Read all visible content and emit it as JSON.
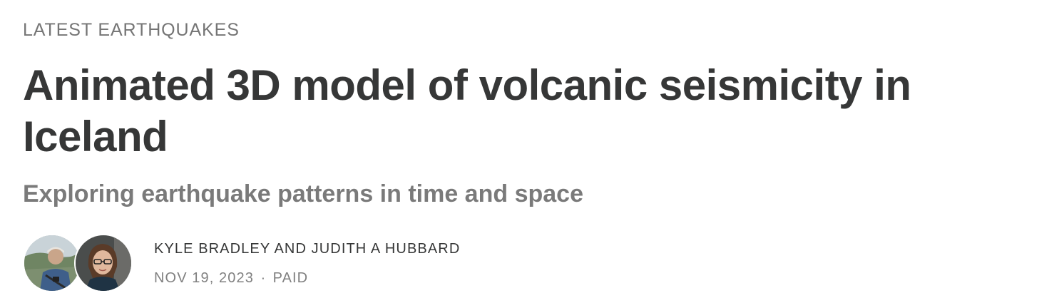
{
  "section": {
    "label": "LATEST EARTHQUAKES"
  },
  "post": {
    "title": "Animated 3D model of volcanic seismicity in Iceland",
    "subtitle": "Exploring earthquake patterns in time and space"
  },
  "byline": {
    "authors": "KYLE BRADLEY AND JUDITH A HUBBARD",
    "date": "NOV 19, 2023",
    "separator": "∙",
    "access": "PAID"
  },
  "avatars": [
    {
      "icon": "author-photo-kyle-bradley"
    },
    {
      "icon": "author-photo-judith-hubbard"
    }
  ],
  "colors": {
    "title": "#363737",
    "muted": "#757575",
    "background": "#ffffff"
  }
}
